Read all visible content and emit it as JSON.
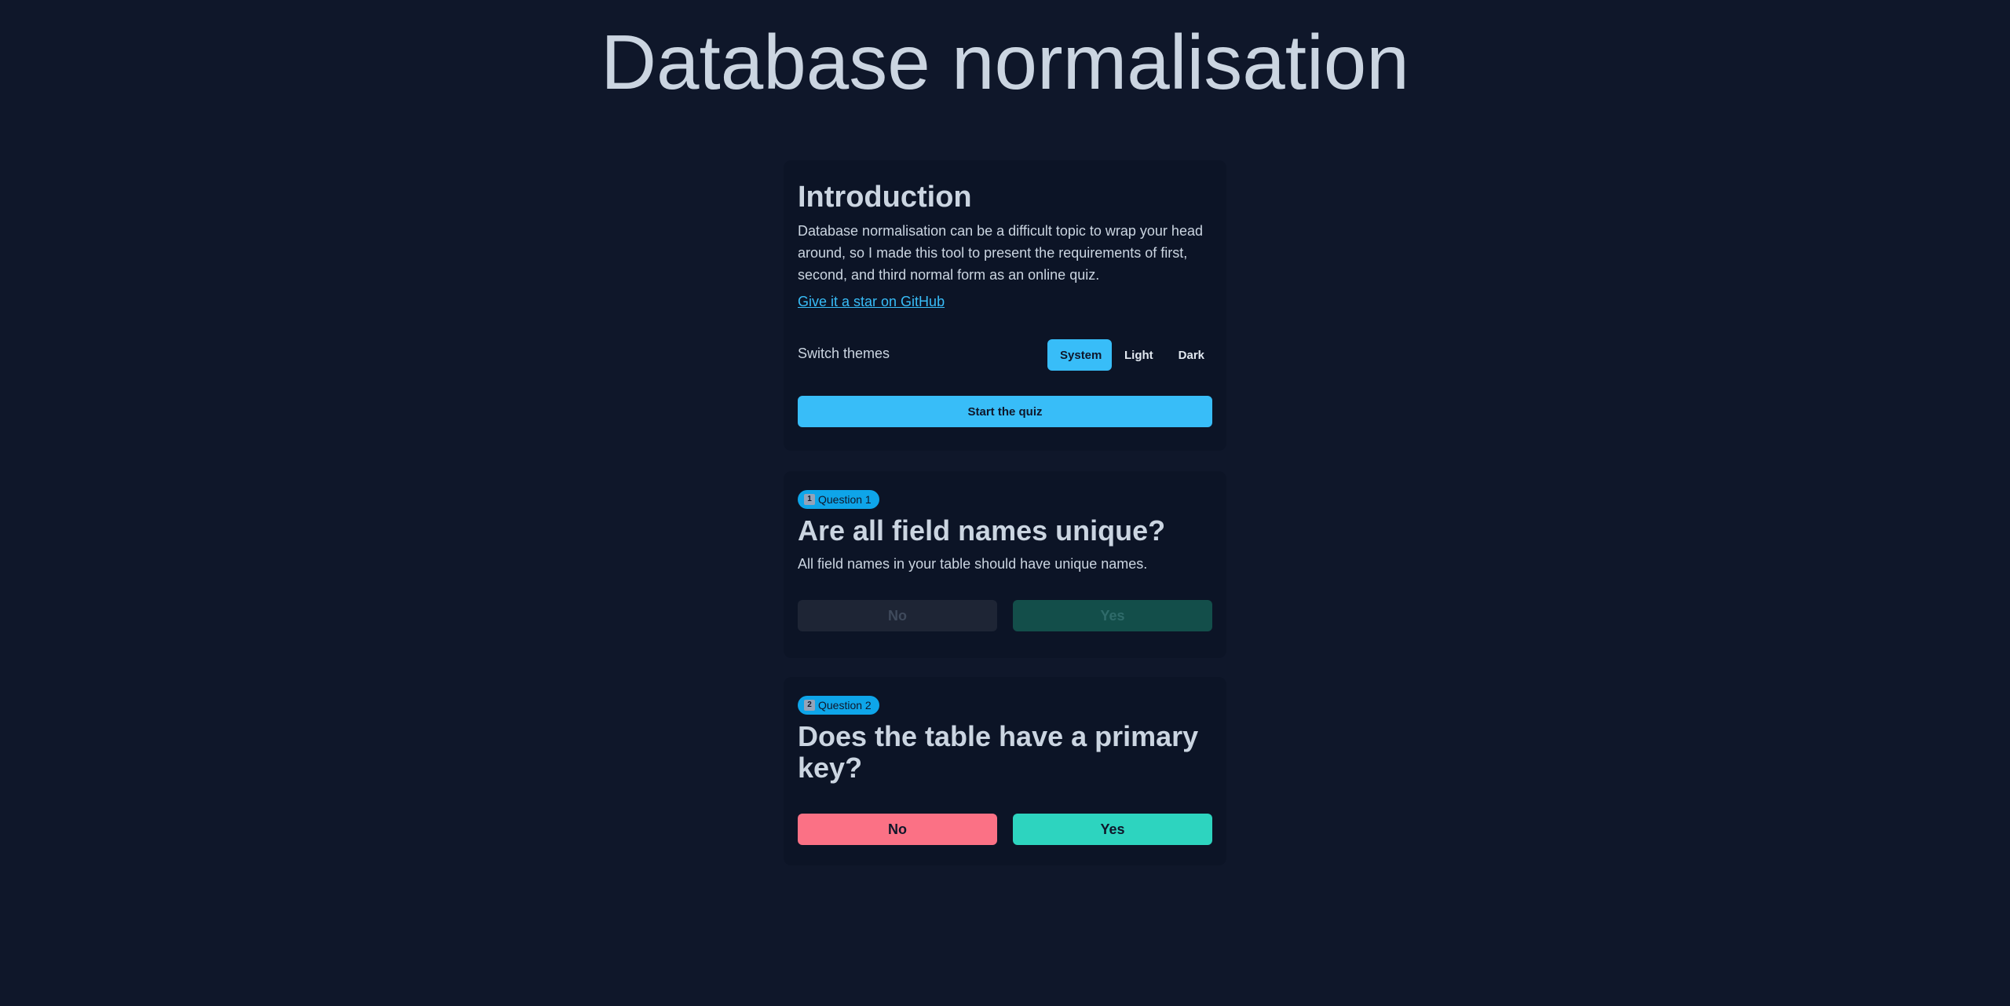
{
  "page": {
    "title": "Database normalisation"
  },
  "intro": {
    "heading": "Introduction",
    "text": "Database normalisation can be a difficult topic to wrap your head around, so I made this tool to present the requirements of first, second, and third normal form as an online quiz.",
    "github_link": "Give it a star on GitHub",
    "theme_label": "Switch themes",
    "themes": [
      "System",
      "Light",
      "Dark"
    ],
    "active_theme": "System",
    "start_button": "Start the quiz"
  },
  "questions": [
    {
      "badge_icon": "1",
      "badge_label": "Question 1",
      "heading": "Are all field names unique?",
      "text": "All field names in your table should have unique names.",
      "no_label": "No",
      "yes_label": "Yes",
      "state": "disabled"
    },
    {
      "badge_icon": "2",
      "badge_label": "Question 2",
      "heading": "Does the table have a primary key?",
      "text": "",
      "no_label": "No",
      "yes_label": "Yes",
      "state": "active"
    }
  ],
  "colors": {
    "background": "#0f172a",
    "accent": "#38bdf8",
    "no": "#fb7185",
    "yes": "#2dd4bf"
  }
}
